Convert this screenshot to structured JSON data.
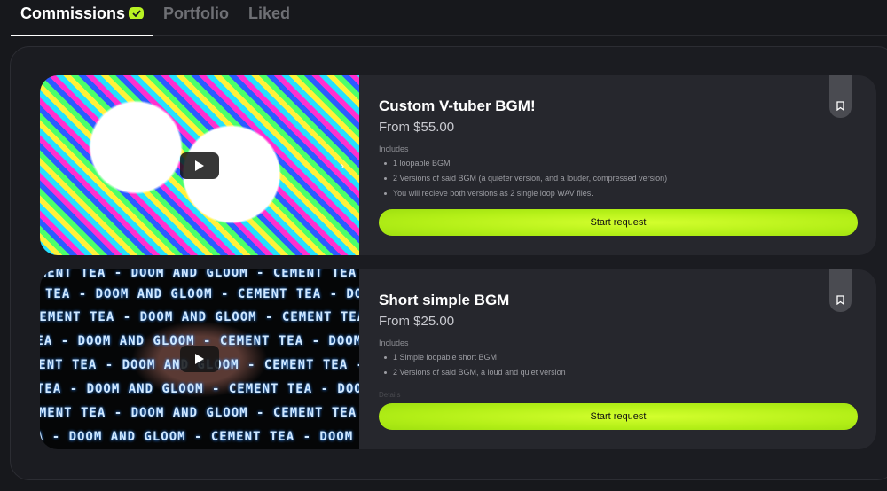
{
  "tabs": [
    {
      "label": "Commissions",
      "active": true
    },
    {
      "label": "Portfolio",
      "active": false
    },
    {
      "label": "Liked",
      "active": false
    }
  ],
  "colors": {
    "accent": "#b8f223",
    "background": "#17181c",
    "card": "#26272d"
  },
  "commissions": [
    {
      "title": "Custom V-tuber BGM!",
      "price": "From $55.00",
      "includes_label": "Includes",
      "includes": [
        "1 loopable BGM",
        "2 Versions of said BGM (a quieter version, and a louder, compressed version)",
        "You will recieve both versions as 2 single loop WAV files."
      ],
      "cta": "Start request"
    },
    {
      "title": "Short simple BGM",
      "price": "From $25.00",
      "includes_label": "Includes",
      "includes": [
        "1 Simple loopable short BGM",
        "2 Versions of said BGM, a loud and quiet version"
      ],
      "faded_label": "Details",
      "cta": "Start request",
      "ticker_text": "CEMENT TEA - DOOM AND GLOOM - CEMENT TEA - DOOM AND GLOOM - CEMENT TEA"
    }
  ]
}
